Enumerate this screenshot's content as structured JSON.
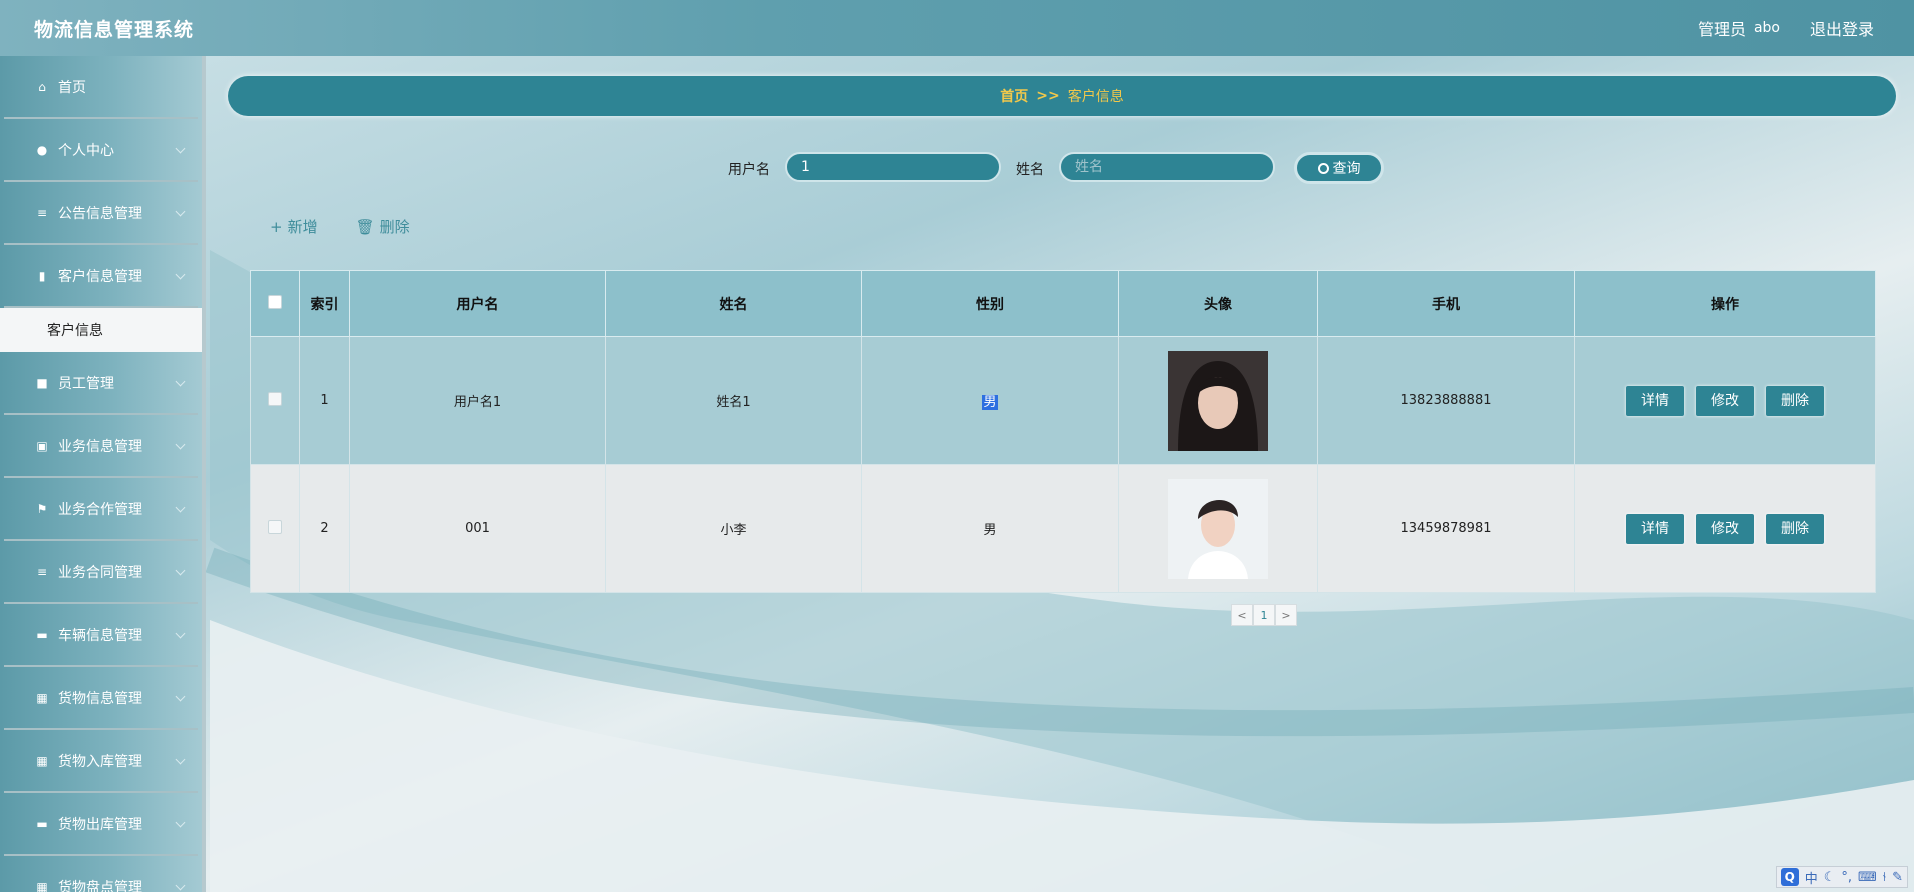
{
  "header": {
    "title": "物流信息管理系统",
    "role": "管理员",
    "user": "abo",
    "logout": "退出登录"
  },
  "sidebar": {
    "items": [
      {
        "label": "首页",
        "icon": "home-icon"
      },
      {
        "label": "个人中心",
        "icon": "person-icon"
      },
      {
        "label": "公告信息管理",
        "icon": "list-icon"
      },
      {
        "label": "客户信息管理",
        "icon": "chart-icon"
      },
      {
        "label": "员工管理",
        "icon": "briefcase-icon"
      },
      {
        "label": "业务信息管理",
        "icon": "clipboard-icon"
      },
      {
        "label": "业务合作管理",
        "icon": "flag-icon"
      },
      {
        "label": "业务合同管理",
        "icon": "list-icon"
      },
      {
        "label": "车辆信息管理",
        "icon": "monitor-icon"
      },
      {
        "label": "货物信息管理",
        "icon": "grid-icon"
      },
      {
        "label": "货物入库管理",
        "icon": "grid-icon"
      },
      {
        "label": "货物出库管理",
        "icon": "chat-icon"
      },
      {
        "label": "货物盘点管理",
        "icon": "grid-icon"
      }
    ],
    "sub_item": "客户信息"
  },
  "breadcrumb": {
    "home": "首页",
    "sep": ">>",
    "current": "客户信息"
  },
  "search": {
    "username_label": "用户名",
    "username_value": "1",
    "name_label": "姓名",
    "name_placeholder": "姓名",
    "button": "查询"
  },
  "actions": {
    "add": "新增",
    "delete": "删除"
  },
  "table": {
    "headers": [
      "索引",
      "用户名",
      "姓名",
      "性别",
      "头像",
      "手机",
      "操作"
    ],
    "rows": [
      {
        "index": "1",
        "username": "用户名1",
        "name": "姓名1",
        "gender": "男",
        "phone": "13823888881"
      },
      {
        "index": "2",
        "username": "001",
        "name": "小李",
        "gender": "男",
        "phone": "13459878981"
      }
    ],
    "buttons": {
      "detail": "详情",
      "edit": "修改",
      "delete": "删除"
    }
  },
  "pager": {
    "prev": "<",
    "page": "1",
    "next": ">"
  },
  "tray": {
    "ime": "中"
  }
}
